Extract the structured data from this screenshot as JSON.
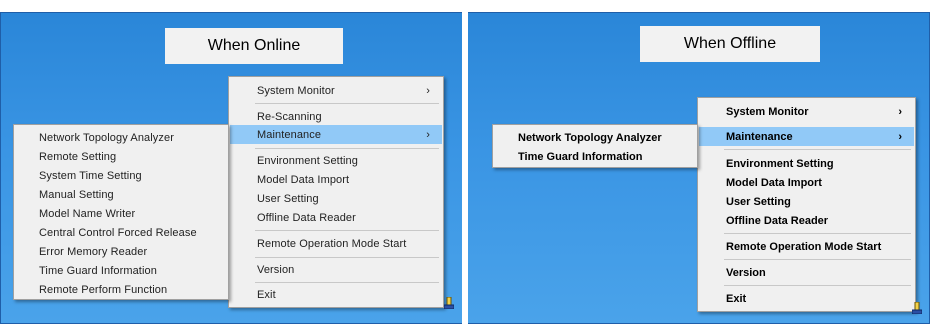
{
  "online": {
    "caption": "When Online",
    "main_menu": [
      {
        "label": "System Monitor",
        "submenu": true
      },
      {
        "label": "Re-Scanning"
      },
      {
        "label": "Maintenance",
        "submenu": true,
        "highlighted": true
      },
      {
        "label": "Environment Setting"
      },
      {
        "label": "Model Data Import"
      },
      {
        "label": "User Setting"
      },
      {
        "label": "Offline Data Reader"
      },
      {
        "label": "Remote Operation Mode Start"
      },
      {
        "label": "Version"
      },
      {
        "label": "Exit"
      }
    ],
    "maintenance_submenu": [
      "Network Topology Analyzer",
      "Remote Setting",
      "System Time Setting",
      "Manual Setting",
      "Model Name Writer",
      "Central Control Forced Release",
      "Error Memory Reader",
      "Time Guard Information",
      "Remote Perform Function"
    ]
  },
  "offline": {
    "caption": "When Offline",
    "main_menu": [
      {
        "label": "System Monitor",
        "submenu": true
      },
      {
        "label": "Maintenance",
        "submenu": true,
        "highlighted": true
      },
      {
        "label": "Environment Setting"
      },
      {
        "label": "Model Data Import"
      },
      {
        "label": "User Setting"
      },
      {
        "label": "Offline Data Reader"
      },
      {
        "label": "Remote Operation Mode Start"
      },
      {
        "label": "Version"
      },
      {
        "label": "Exit"
      }
    ],
    "maintenance_submenu": [
      "Network Topology Analyzer",
      "Time Guard Information"
    ]
  },
  "colors": {
    "desktop": "#3a95e4",
    "menu_bg": "#f0f0f0",
    "highlight": "#91c9f7"
  },
  "icons": {
    "submenu_arrow": "chevron-right-icon",
    "tray": "tray-app-icon"
  }
}
